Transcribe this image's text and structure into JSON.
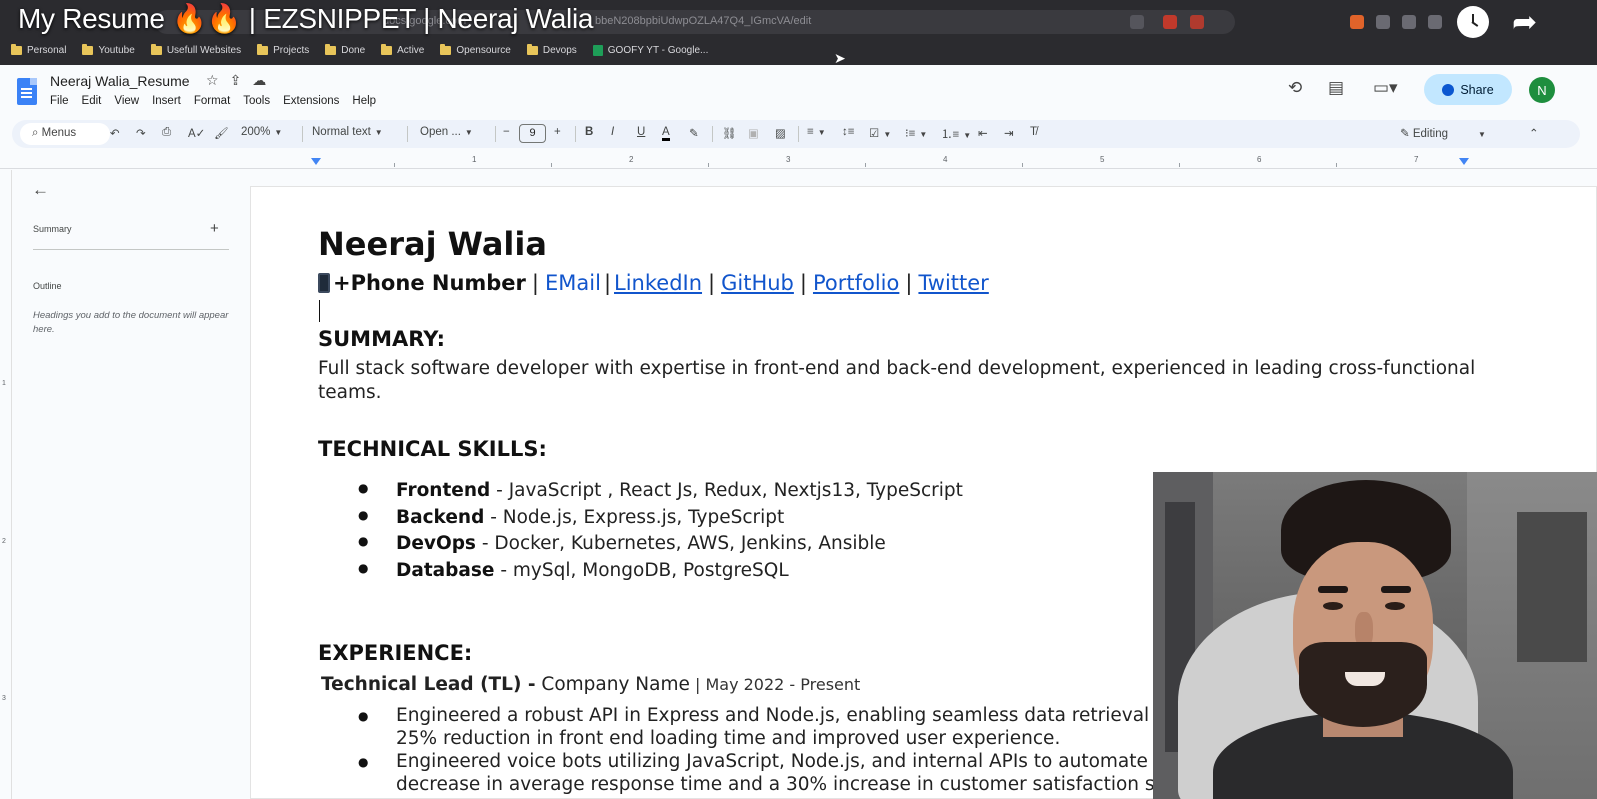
{
  "video": {
    "title": "My Resume 🔥🔥 | EZSNIPPET | Neeraj Walia"
  },
  "browser": {
    "url_host": "docs.google.com",
    "url_path": "bbeN208bpbiUdwpOZLA47Q4_IGmcVA/edit",
    "bookmarks": [
      "Personal",
      "Youtube",
      "Usefull Websites",
      "Projects",
      "Done",
      "Active",
      "Opensource",
      "Devops"
    ],
    "bookmark_sheet": "GOOFY YT - Google..."
  },
  "docs": {
    "title": "Neeraj Walia_Resume",
    "menu": [
      "File",
      "Edit",
      "View",
      "Insert",
      "Format",
      "Tools",
      "Extensions",
      "Help"
    ],
    "share_label": "Share",
    "avatar_initial": "N",
    "toolbar": {
      "menus": "Menus",
      "zoom": "200%",
      "style": "Normal text",
      "font": "Open ...",
      "font_size": "9",
      "mode": "Editing"
    },
    "ruler_numbers": [
      "1",
      "2",
      "3",
      "4",
      "5",
      "6",
      "7"
    ],
    "left_ruler_numbers": [
      "1",
      "2",
      "3"
    ],
    "outline": {
      "summary_label": "Summary",
      "outline_label": "Outline",
      "hint": "Headings you add to the document will appear here."
    }
  },
  "resume": {
    "name": "Neeraj Walia",
    "contact": {
      "phone": "+Phone Number",
      "email": "EMail",
      "linkedin": "LinkedIn",
      "github": "GitHub",
      "portfolio": "Portfolio",
      "twitter": "Twitter",
      "separator": "|"
    },
    "summary_heading": "SUMMARY:",
    "summary_text": "Full stack software developer with expertise in front-end and back-end development, experienced in leading cross-functional teams.",
    "skills_heading": "TECHNICAL SKILLS:",
    "skills": [
      {
        "label": "Frontend",
        "value": " - JavaScript , React Js, Redux, Nextjs13, TypeScript"
      },
      {
        "label": "Backend",
        "value": " - Node.js, Express.js, TypeScript"
      },
      {
        "label": "DevOps",
        "value": " - Docker, Kubernetes, AWS, Jenkins, Ansible"
      },
      {
        "label": "Database",
        "value": " - mySql, MongoDB, PostgreSQL"
      }
    ],
    "experience_heading": "EXPERIENCE:",
    "role_title": "Technical Lead (TL) -",
    "company": " Company Name",
    "dates": " | May 2022 - Present",
    "experience_bullets": [
      "Engineered a robust API in Express and Node.js, enabling seamless data retrieval fr 25% reduction in front end loading time and improved user experience.",
      "Engineered voice bots utilizing JavaScript, Node.js, and internal APIs to automate cu decrease in average response time and a 30% increase in customer satisfaction sco"
    ]
  },
  "colors": {
    "link": "#1155cc",
    "share_bg": "#c2e7ff",
    "toolbar_bg": "#edf2fa"
  }
}
